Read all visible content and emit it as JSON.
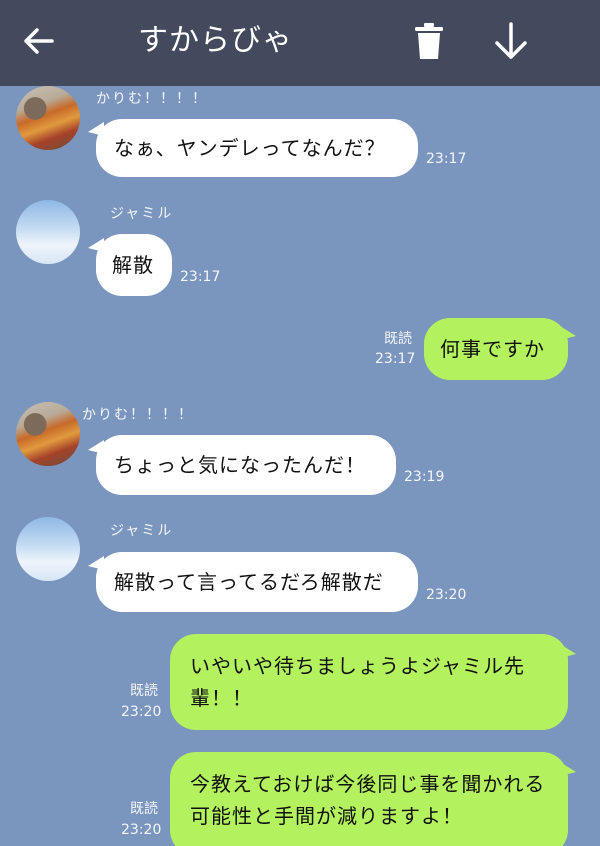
{
  "header": {
    "title": "すからびゃ",
    "back_icon": "arrow-left-icon",
    "delete_icon": "trash-icon",
    "download_icon": "arrow-down-icon"
  },
  "senders": {
    "karimu": "かりむ！！！！",
    "jamil": "ジャミル"
  },
  "messages": [
    {
      "sender": "かりむ！！！！",
      "text": "なぁ、ヤンデレってなんだ？",
      "time": "23:17"
    },
    {
      "sender": "ジャミル",
      "text": "解散",
      "time": "23:17"
    },
    {
      "read": "既読",
      "text": "何事ですか",
      "time": "23:17"
    },
    {
      "sender": "かりむ！！！！",
      "text": "ちょっと気になったんだ！",
      "time": "23:19"
    },
    {
      "sender": "ジャミル",
      "text": "解散って言ってるだろ解散だ",
      "time": "23:20"
    },
    {
      "read": "既読",
      "text": "いやいや待ちましょうよジャミル先輩！！",
      "time": "23:20"
    },
    {
      "read": "既読",
      "text": "今教えておけば今後同じ事を聞かれる可能性と手間が減りますよ！",
      "time": "23:20"
    }
  ],
  "colors": {
    "background": "#7b96be",
    "header": "#444a5e",
    "incoming_bubble": "#ffffff",
    "outgoing_bubble": "#b4f15e"
  }
}
